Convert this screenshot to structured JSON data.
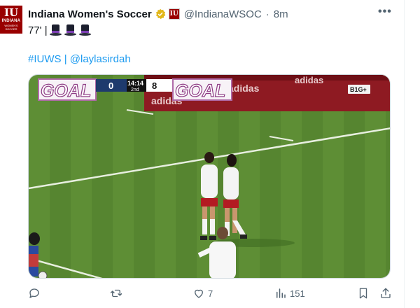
{
  "account": {
    "name": "Indiana Women's Soccer",
    "handle": "@IndianaWSOC",
    "separator": "·",
    "time": "8m",
    "avatar_text": [
      "IU",
      "INDIANA",
      "WOMEN'S",
      "SOCCER"
    ],
    "affiliate_badge_text": "IU"
  },
  "tweet": {
    "line1_text": "77' |",
    "line1_emoji": [
      "top-hat-emoji",
      "top-hat-emoji",
      "top-hat-emoji"
    ],
    "hashtag": "#IUWS",
    "divider": "|",
    "mention": "@laylasirdah"
  },
  "media": {
    "scorebug": {
      "goal_left": "GOAL",
      "goal_right": "GOAL",
      "away_score": "0",
      "clock": "14:14",
      "period": "2nd",
      "home_score": "8",
      "network": "B1G+"
    },
    "board_text": [
      "adidas",
      "adidas",
      "adidas"
    ]
  },
  "actions": {
    "reply_count": "",
    "repost_count": "",
    "like_count": "7",
    "views_count": "151"
  },
  "colors": {
    "brand": "#990000",
    "link": "#1d9bf0",
    "verified": "#e2b719",
    "muted": "#536471",
    "pitch": "#5a8a32"
  }
}
